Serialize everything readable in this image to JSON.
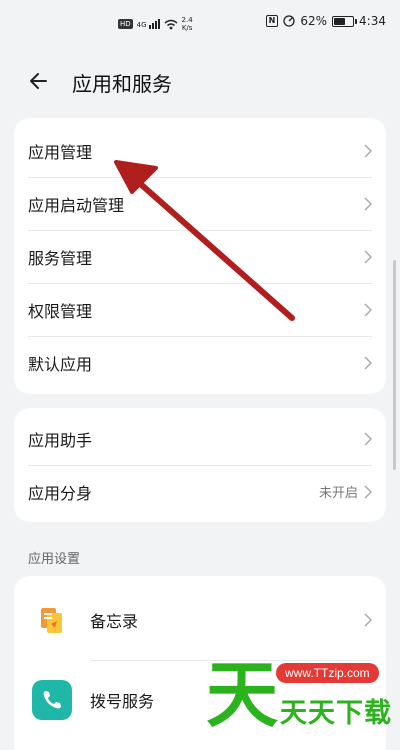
{
  "status_bar": {
    "network_badge": "HD",
    "signal_label": "4G",
    "speed_value": "2.4",
    "speed_unit": "K/s",
    "nfc_label": "N",
    "battery_percent": "62%",
    "battery_level": 0.62,
    "time": "4:34"
  },
  "header": {
    "title": "应用和服务"
  },
  "group1": {
    "items": [
      {
        "label": "应用管理"
      },
      {
        "label": "应用启动管理"
      },
      {
        "label": "服务管理"
      },
      {
        "label": "权限管理"
      },
      {
        "label": "默认应用"
      }
    ]
  },
  "group2": {
    "items": [
      {
        "label": "应用助手",
        "value": ""
      },
      {
        "label": "应用分身",
        "value": "未开启"
      }
    ]
  },
  "app_settings": {
    "section_title": "应用设置",
    "items": [
      {
        "label": "备忘录",
        "icon": "memo-icon",
        "color": "#f29a38"
      },
      {
        "label": "拨号服务",
        "icon": "phone-icon",
        "color": "#1fb8a8"
      }
    ]
  },
  "watermark": {
    "big_char": "天",
    "url": "www.TTzip.com",
    "text": "天天下载"
  },
  "colors": {
    "annotation_red": "#b01e1e",
    "watermark_green": "#2bb31e",
    "watermark_red": "#e53935"
  }
}
